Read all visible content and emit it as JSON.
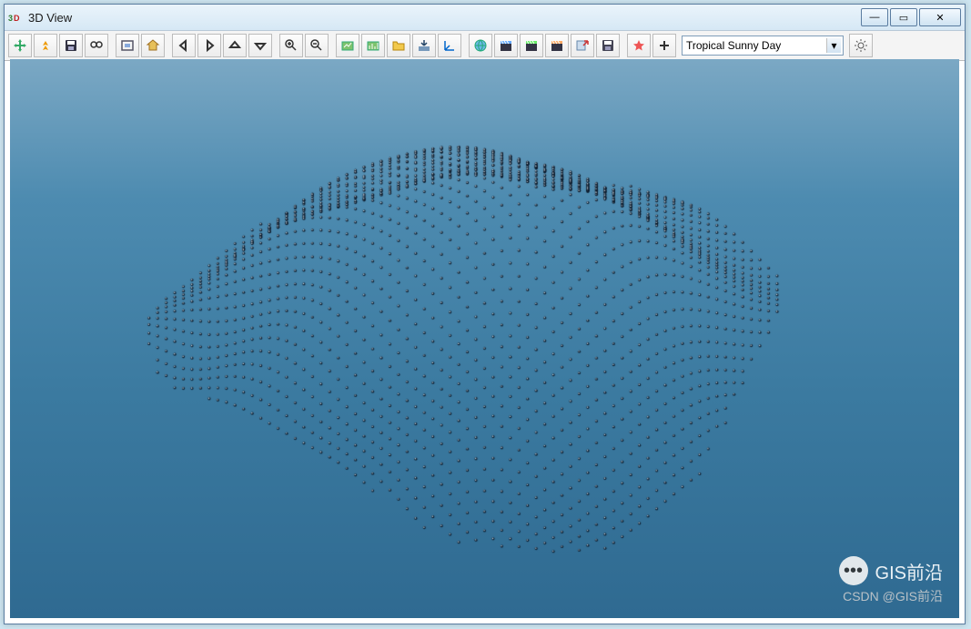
{
  "window": {
    "title": "3D View",
    "app_icon_label": "3D"
  },
  "win_controls": {
    "minimize": "—",
    "maximize": "▭",
    "close": "✕"
  },
  "toolbar": {
    "dropdown_selected": "Tropical Sunny Day",
    "icons": {
      "pan": "pan-icon",
      "fly": "fly-icon",
      "save": "save-icon",
      "find": "find-icon",
      "frame": "frame-icon",
      "home": "home-icon",
      "back": "back-arrow-icon",
      "forward": "forward-arrow-icon",
      "up": "up-arrow-icon",
      "down": "down-arrow-icon",
      "zoomin": "zoom-in-icon",
      "zoomout": "zoom-out-icon",
      "layer1": "layer-tool-icon",
      "layer2": "chart-tool-icon",
      "folder": "folder-open-icon",
      "import": "import-down-icon",
      "axes": "axes-icon",
      "globe": "globe-icon",
      "clap": "clapper-icon",
      "clap2": "clapper-b-icon",
      "clap3": "clapper-c-icon",
      "export": "export-arrow-icon",
      "disk": "floppy-icon",
      "star": "star-icon",
      "plus": "plus-icon",
      "bug": "settings-icon"
    }
  },
  "watermark": {
    "brand": "GIS前沿",
    "credit": "CSDN @GIS前沿",
    "bubble_glyph": "•••"
  }
}
